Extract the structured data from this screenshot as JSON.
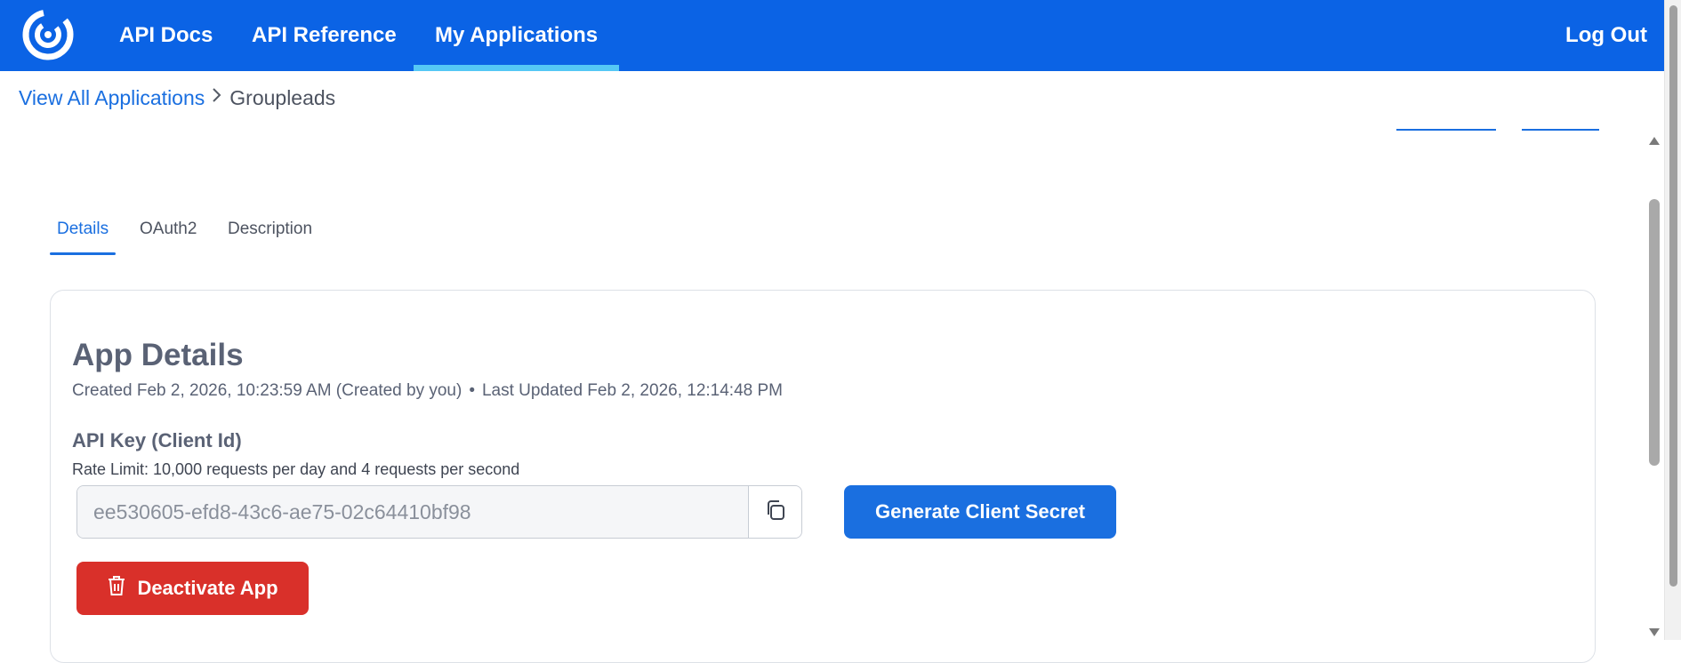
{
  "nav": {
    "items": [
      {
        "label": "API Docs"
      },
      {
        "label": "API Reference"
      },
      {
        "label": "My Applications"
      }
    ],
    "active": "My Applications",
    "logout_label": "Log Out"
  },
  "breadcrumb": {
    "link_label": "View All Applications",
    "separator": ">",
    "current": "Groupleads"
  },
  "tabs": [
    {
      "label": "Details"
    },
    {
      "label": "OAuth2"
    },
    {
      "label": "Description"
    }
  ],
  "active_tab": "Details",
  "app_details": {
    "title": "App Details",
    "created": "Created Feb 2, 2026, 10:23:59 AM (Created by you)",
    "separator": "•",
    "updated": "Last Updated Feb 2, 2026, 12:14:48 PM",
    "api_key_label": "API Key (Client Id)",
    "rate_limit": "Rate Limit: 10,000 requests per day and 4 requests per second",
    "api_key_value": "ee530605-efd8-43c6-ae75-02c64410bf98",
    "generate_secret_label": "Generate Client Secret",
    "deactivate_label": "Deactivate App"
  },
  "colors": {
    "nav_bg": "#0b63e5",
    "nav_active_underline": "#55c8f5",
    "link": "#1a6fe0",
    "primary_button": "#1a6fe0",
    "danger_button": "#d9302a"
  },
  "icons": {
    "logo": "constant-contact-logo",
    "copy": "copy-icon",
    "delete": "trash-icon",
    "breadcrumb_separator": "chevron-right-icon"
  }
}
